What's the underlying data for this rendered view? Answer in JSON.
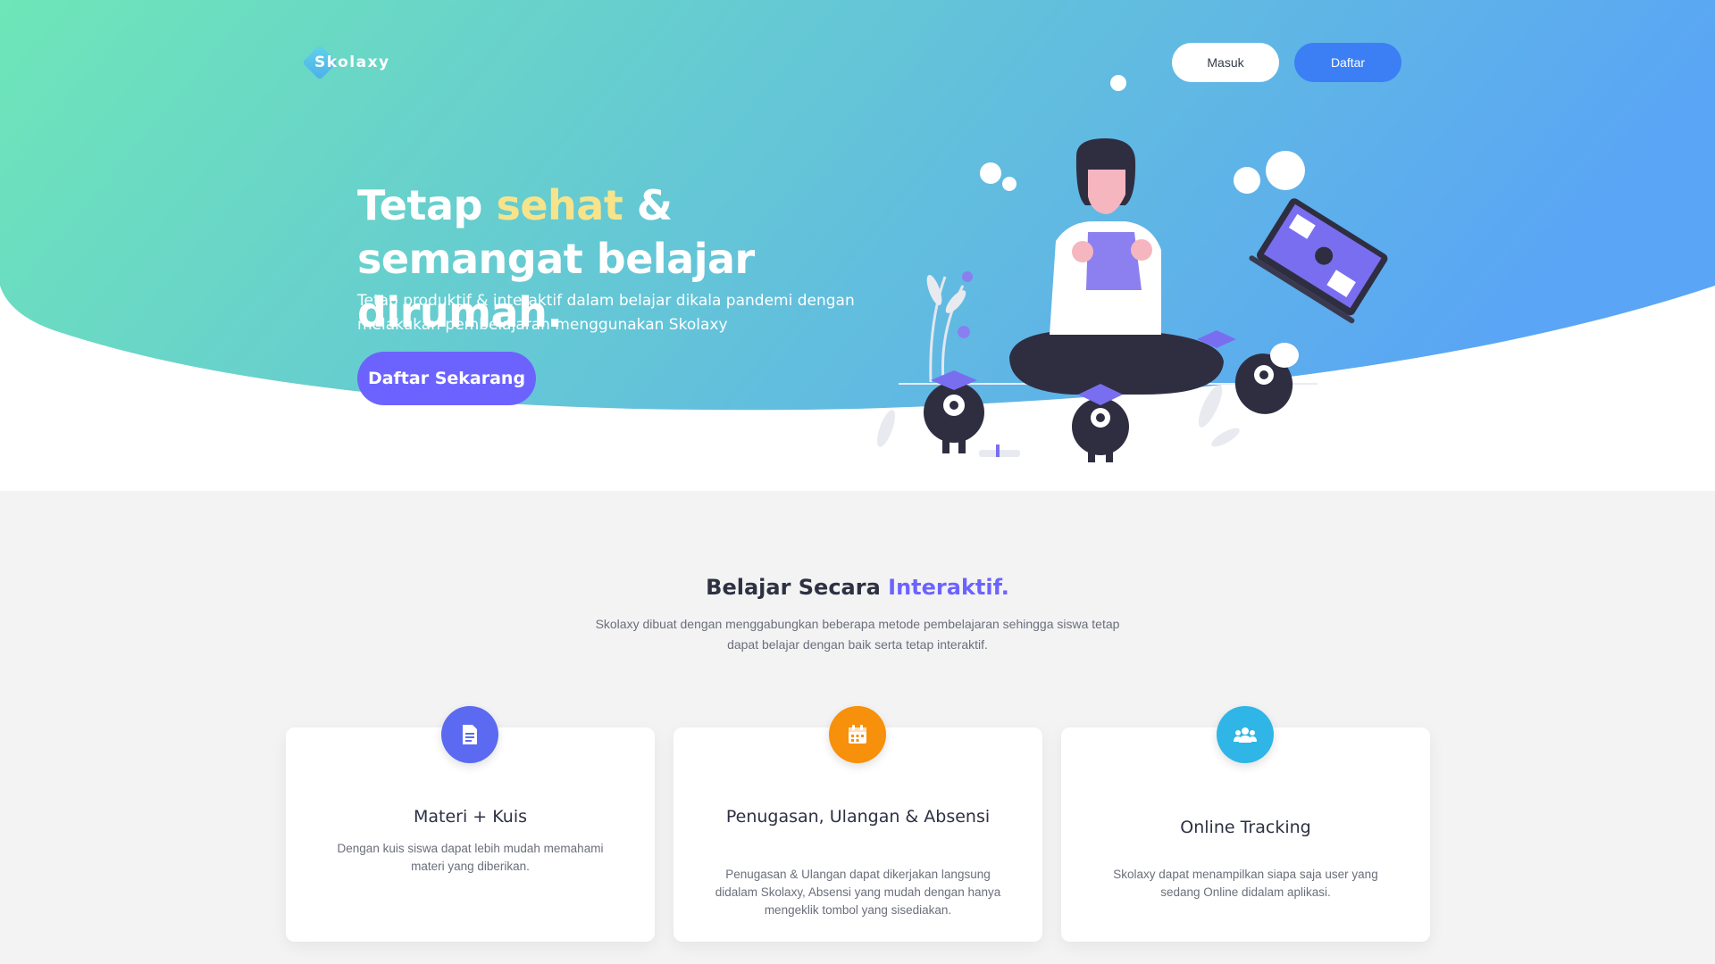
{
  "brand": {
    "name": "Skolaxy"
  },
  "nav": {
    "login_label": "Masuk",
    "register_label": "Daftar"
  },
  "hero": {
    "title_part1": "Tetap ",
    "title_accent": "sehat",
    "title_part2": " & semangat belajar dirumah.",
    "subtitle": "Tetap produktif & interaktif dalam belajar dikala pandemi dengan melakukan pembelajaran menggunakan Skolaxy",
    "cta_label": "Daftar Sekarang"
  },
  "features": {
    "title_part1": "Belajar Secara ",
    "title_accent": "Interaktif.",
    "subtitle": "Skolaxy dibuat dengan menggabungkan beberapa metode pembelajaran sehingga siswa tetap dapat belajar dengan baik serta tetap interaktif.",
    "cards": [
      {
        "icon": "document-icon",
        "color": "#5b6af0",
        "title": "Materi + Kuis",
        "desc": "Dengan kuis siswa dapat lebih mudah memahami materi yang diberikan."
      },
      {
        "icon": "calendar-icon",
        "color": "#f7900a",
        "title": "Penugasan, Ulangan & Absensi",
        "desc": "Penugasan & Ulangan dapat dikerjakan langsung didalam Skolaxy, Absensi yang mudah dengan hanya mengeklik tombol yang sisediakan."
      },
      {
        "icon": "users-icon",
        "color": "#2fb5e6",
        "title": "Online Tracking",
        "desc": "Skolaxy dapat menampilkan siapa saja user yang sedang Online didalam aplikasi."
      }
    ]
  },
  "colors": {
    "hero_gradient_start": "#6ee6b8",
    "hero_gradient_end": "#5aa5f5",
    "accent_purple": "#6c63ff",
    "accent_yellow": "#f7e48a",
    "primary_blue": "#3c7ff5"
  }
}
